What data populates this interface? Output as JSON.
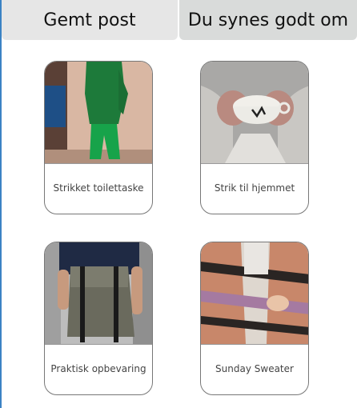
{
  "tabs": {
    "saved_label": "Gemt post",
    "liked_label": "Du synes godt om"
  },
  "cards": [
    {
      "caption": "Strikket toilettaske",
      "image": "woman-green-knit-outfit-photo"
    },
    {
      "caption": "Strik til hjemmet",
      "image": "hands-mittens-holding-mug-photo"
    },
    {
      "caption": "Praktisk opbevaring",
      "image": "man-with-backpack-photo"
    },
    {
      "caption": "Sunday Sweater",
      "image": "striped-sweater-photo"
    }
  ]
}
